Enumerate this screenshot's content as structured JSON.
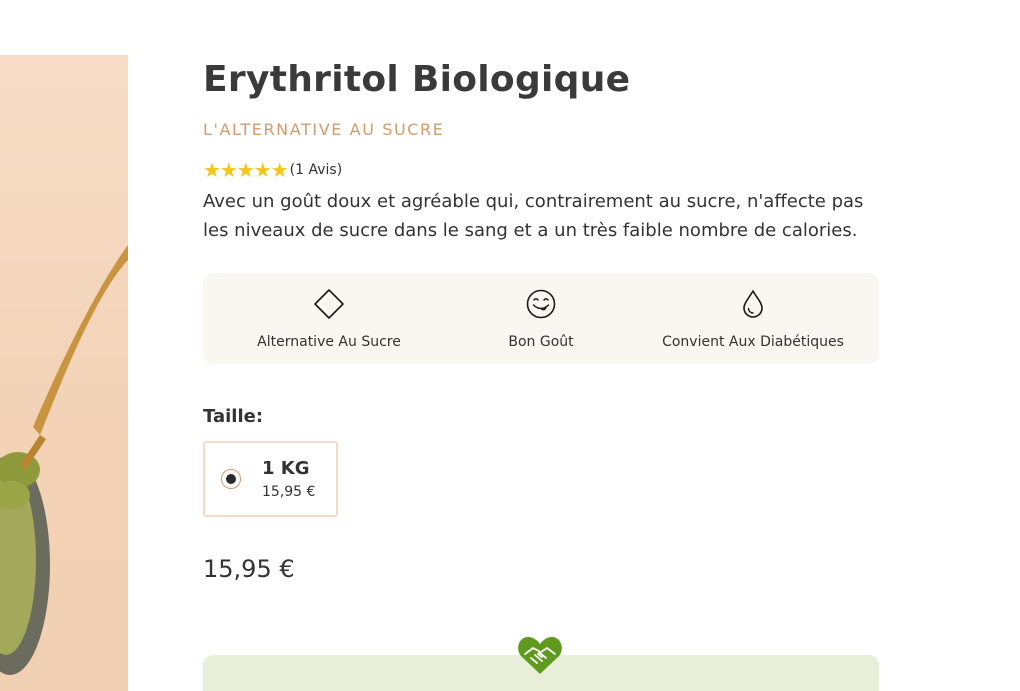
{
  "product": {
    "title": "Erythritol Biologique",
    "subtitle": "L'ALTERNATIVE AU SUCRE",
    "rating": {
      "stars": "★★★★★",
      "value": 5,
      "max": 5,
      "count_text": "(1 Avis)"
    },
    "description": "Avec un goût doux et agréable qui, contrairement au sucre, n'affecte pas les niveaux de sucre dans le sang et a un très faible nombre de calories.",
    "features": [
      {
        "icon": "diamond-icon",
        "label": "Alternative Au Sucre"
      },
      {
        "icon": "yummy-face-icon",
        "label": "Bon Goût"
      },
      {
        "icon": "drop-icon",
        "label": "Convient Aux Diabétiques"
      }
    ],
    "size": {
      "label": "Taille:",
      "options": [
        {
          "name": "1 KG",
          "price": "15,95 €",
          "selected": true
        }
      ]
    },
    "price": "15,95 €"
  },
  "promo": {
    "icon": "heart-handshake-icon"
  },
  "colors": {
    "accent": "#d49a6a",
    "star": "#f5c518",
    "feature_bg": "#faf6f1",
    "promo_bg": "#e8efd9",
    "promo_icon": "#5e9a1e"
  }
}
